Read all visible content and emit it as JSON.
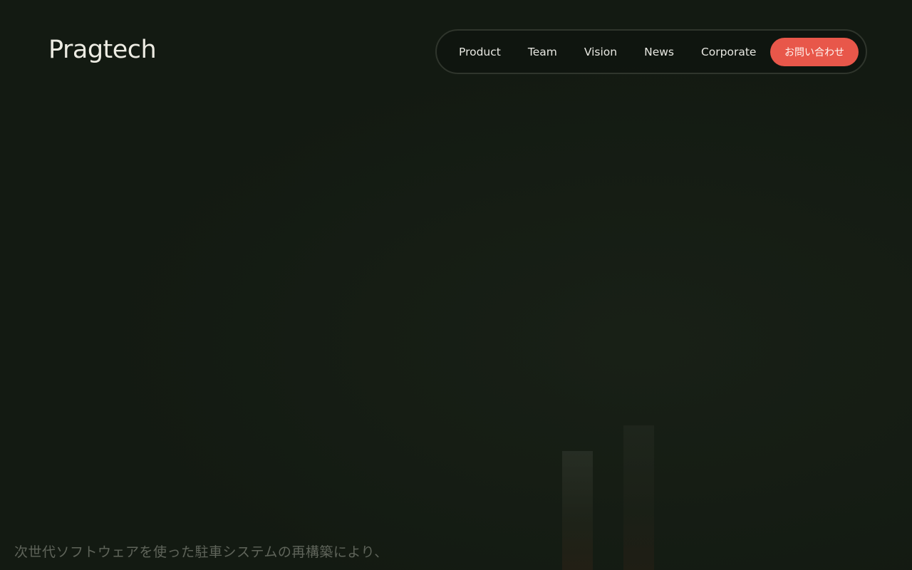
{
  "brand": {
    "logo_text": "Pragtech"
  },
  "nav": {
    "items": [
      {
        "label": "Product"
      },
      {
        "label": "Team"
      },
      {
        "label": "Vision"
      },
      {
        "label": "News"
      },
      {
        "label": "Corporate"
      }
    ],
    "cta_label": "お問い合わせ"
  },
  "hero": {
    "text": "次世代ソフトウェアを使った駐車システムの再構築により、"
  },
  "colors": {
    "background": "#131a12",
    "accent": "#e8574a",
    "text": "#ecebe2"
  }
}
